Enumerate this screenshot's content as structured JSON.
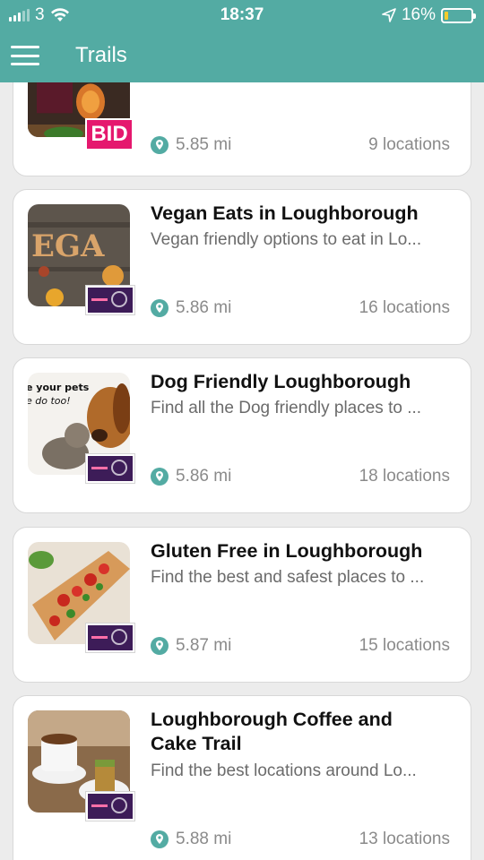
{
  "status": {
    "carrier": "3",
    "time": "18:37",
    "battery_percent_label": "16%",
    "battery_level": 0.16
  },
  "header": {
    "title": "Trails"
  },
  "trails": [
    {
      "title": "",
      "subtitle": "",
      "distance": "5.85 mi",
      "locations": "9 locations",
      "thumb_badge": "BID"
    },
    {
      "title": "Vegan Eats in Loughborough",
      "subtitle": "Vegan friendly options to eat in Lo...",
      "distance": "5.86 mi",
      "locations": "16 locations",
      "thumb_text": "EGA"
    },
    {
      "title": "Dog Friendly Loughborough",
      "subtitle": "Find all the Dog friendly places to ...",
      "distance": "5.86 mi",
      "locations": "18 locations",
      "thumb_text_1": "e your pets",
      "thumb_text_2": "e do too!"
    },
    {
      "title": "Gluten Free in Loughborough",
      "subtitle": "Find the best and safest places to ...",
      "distance": "5.87 mi",
      "locations": "15 locations"
    },
    {
      "title": "Loughborough Coffee and Cake Trail",
      "subtitle": "Find the best locations around Lo...",
      "distance": "5.88 mi",
      "locations": "13 locations"
    }
  ],
  "colors": {
    "accent": "#53aba3",
    "badge_purple": "#3d1c58",
    "bid_pink": "#e5186e"
  },
  "icons": {
    "menu": "hamburger-menu-icon",
    "distance": "location-pin-icon",
    "wifi": "wifi-icon",
    "location_services": "location-arrow-icon"
  }
}
